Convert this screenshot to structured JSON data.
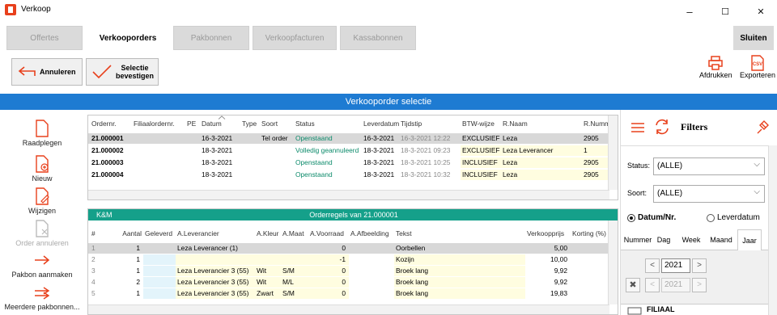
{
  "window": {
    "title": "Verkoop",
    "minimize": "–",
    "maximize": "☐",
    "close": "✕"
  },
  "tabs": [
    {
      "label": "Offertes"
    },
    {
      "label": "Verkooporders"
    },
    {
      "label": "Pakbonnen"
    },
    {
      "label": "Verkoopfacturen"
    },
    {
      "label": "Kassabonnen"
    }
  ],
  "close_button": "Sluiten",
  "toolbar": {
    "cancel": "Annuleren",
    "confirm_line1": "Selectie",
    "confirm_line2": "bevestigen",
    "print": "Afdrukken",
    "export": "Exporteren",
    "export_badge": "CSV"
  },
  "section_title": "Verkooporder selectie",
  "left_actions": [
    {
      "label": "Raadplegen"
    },
    {
      "label": "Nieuw"
    },
    {
      "label": "Wijzigen"
    },
    {
      "label": "Order annuleren"
    },
    {
      "label": "Pakbon aanmaken"
    },
    {
      "label": "Meerdere pakbonnen..."
    }
  ],
  "orders": {
    "columns": [
      "Ordernr.",
      "Filiaalordernr.",
      "PE",
      "Datum",
      "Type",
      "Soort",
      "Status",
      "Leverdatum",
      "Tijdstip",
      "BTW-wijze",
      "R.Naam",
      "R.Numm"
    ],
    "rows": [
      [
        "21.000001",
        "",
        "",
        "16-3-2021",
        "",
        "Tel order",
        "Openstaand",
        "16-3-2021",
        "16-3-2021 12:22",
        "EXCLUSIEF",
        "Leza",
        "2905"
      ],
      [
        "21.000002",
        "",
        "",
        "18-3-2021",
        "",
        "",
        "Volledig geannuleerd",
        "18-3-2021",
        "18-3-2021 09:23",
        "EXCLUSIEF",
        "Leza Leverancer",
        "1"
      ],
      [
        "21.000003",
        "",
        "",
        "18-3-2021",
        "",
        "",
        "Openstaand",
        "18-3-2021",
        "18-3-2021 10:25",
        "INCLUSIEF",
        "Leza",
        "2905"
      ],
      [
        "21.000004",
        "",
        "",
        "18-3-2021",
        "",
        "",
        "Openstaand",
        "18-3-2021",
        "18-3-2021 10:32",
        "INCLUSIEF",
        "Leza",
        "2905"
      ]
    ]
  },
  "orderlines": {
    "branch_tag": "K&M",
    "title": "Orderregels van 21.000001",
    "columns": [
      "#",
      "Aantal",
      "Geleverd",
      "A.Leverancier",
      "A.Kleur",
      "A.Maat",
      "A.Voorraad",
      "A.Afbeelding",
      "Tekst",
      "Verkoopprijs",
      "Korting (%)"
    ],
    "rows": [
      [
        "1",
        "1",
        "",
        "Leza Leverancer (1)",
        "",
        "",
        "0",
        "",
        "Oorbellen",
        "5,00",
        ""
      ],
      [
        "2",
        "1",
        "",
        "",
        "",
        "",
        "-1",
        "",
        "Kozijn",
        "10,00",
        ""
      ],
      [
        "3",
        "1",
        "",
        "Leza Leverancier 3 (55)",
        "Wit",
        "S/M",
        "0",
        "",
        "Broek lang",
        "9,92",
        ""
      ],
      [
        "4",
        "2",
        "",
        "Leza Leverancier 3 (55)",
        "Wit",
        "M/L",
        "0",
        "",
        "Broek lang",
        "9,92",
        ""
      ],
      [
        "5",
        "1",
        "",
        "Leza Leverancier 3 (55)",
        "Zwart",
        "S/M",
        "0",
        "",
        "Broek lang",
        "19,83",
        ""
      ]
    ]
  },
  "filters": {
    "title": "Filters",
    "status_label": "Status:",
    "status_value": "(ALLE)",
    "soort_label": "Soort:",
    "soort_value": "(ALLE)",
    "radio_date": "Datum/Nr.",
    "radio_delivery": "Leverdatum",
    "period_tabs": [
      "Nummer",
      "Dag",
      "Week",
      "Maand",
      "Jaar"
    ],
    "year": "2021",
    "year_disabled": "2021",
    "prev": "<",
    "next": ">",
    "branch_label": "FILIAAL"
  },
  "colors": {
    "accent": "#1e7bd2",
    "teal": "#15a08a",
    "icon_red": "#e8401c"
  }
}
